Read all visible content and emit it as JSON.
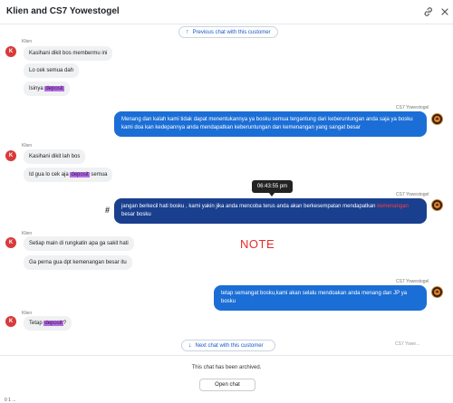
{
  "header": {
    "title": "Klien and CS7 Yowestogel",
    "link_icon": "link-icon",
    "close_icon": "close-icon"
  },
  "nav": {
    "prev_label": "Previous chat with this customer",
    "next_label": "Next chat with this customer"
  },
  "messages": [
    {
      "sender": "Klien",
      "lines": [
        {
          "pre": "Kasihani dikit bos membermu ini",
          "hl": "",
          "post": ""
        },
        {
          "pre": "Lo cek semua dah",
          "hl": "",
          "post": ""
        },
        {
          "pre": "Isinya ",
          "hl": "deposit",
          "post": ""
        }
      ]
    },
    {
      "sender": "CS7 Yowestogel",
      "text": "Menang dan kalah kami tidak dapat menentukannya ya bosku semua tergantung dari keberuntungan anda saja ya bosku kami doa kan kedepannya anda mendapatkan keberuntungan dan kemenangan yang sangat besar"
    },
    {
      "sender": "Klien",
      "lines": [
        {
          "pre": "Kasihani dikit lah bos",
          "hl": "",
          "post": ""
        },
        {
          "pre": "Id gua lo cek aja ",
          "hl": "deposit",
          "post": " semua"
        }
      ]
    },
    {
      "sender": "CS7 Yowestogel",
      "text_pre": "jangan berkecil hati bosku , kami yakin jika anda mencoba terus anda akan berkesempatan mendapatkan ",
      "text_mark": "kemenangan",
      "text_post": " besar bosku",
      "time": "06:43:55 pm"
    },
    {
      "sender": "Klien",
      "lines": [
        {
          "pre": "Setiap main di rungkatin apa ga sakit hati",
          "hl": "",
          "post": ""
        },
        {
          "pre": "Ga perna gua dpt kemenangan besar itu",
          "hl": "",
          "post": ""
        }
      ]
    },
    {
      "sender": "CS7 Yowestogel",
      "text": "tetap semangat bosku,kami akan selalu mendoakan anda menang dan JP ya bosku"
    },
    {
      "sender": "Klien",
      "lines": [
        {
          "pre": "Tetap ",
          "hl": "deposit",
          "post": "?"
        }
      ]
    }
  ],
  "annotations": {
    "hash": "#",
    "note": "NOTE"
  },
  "avatar_initial": "K",
  "truncated_peek": "CS7 Yowe...",
  "footer": {
    "archived_text": "This chat has been archived.",
    "open_chat_label": "Open chat",
    "peek_text": "0 1 ..."
  },
  "colors": {
    "agent_bubble": "#1b6ed6",
    "agent_bubble_selected": "#1a3f8f",
    "customer_bubble": "#f0f1f3",
    "customer_avatar": "#d83a3a",
    "highlight": "#b46ee0",
    "note_red": "#e52b2b",
    "link_blue": "#1a56c9"
  }
}
